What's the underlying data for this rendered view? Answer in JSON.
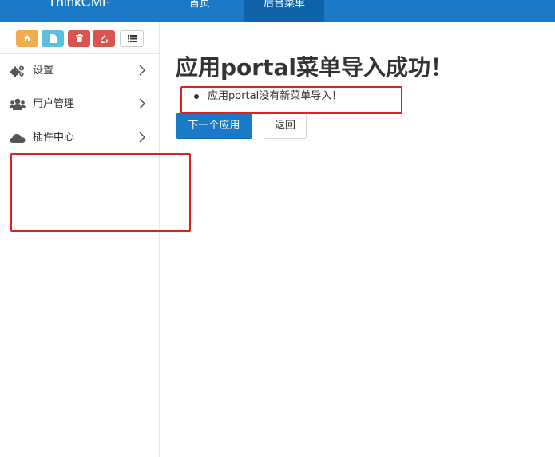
{
  "header": {
    "brand": "ThinkCMF",
    "nav": [
      {
        "label": "首页",
        "active": false
      },
      {
        "label": "后台菜单",
        "active": true
      }
    ],
    "colors": {
      "bar": "#1a7ac7",
      "active": "#0e63ab"
    }
  },
  "sidebar": {
    "shortcuts": [
      {
        "icon": "home-icon",
        "color": "#f0ad4e"
      },
      {
        "icon": "file-icon",
        "color": "#5bc0de"
      },
      {
        "icon": "trash-icon",
        "color": "#d9534f"
      },
      {
        "icon": "recycle-icon",
        "color": "#d9534f"
      },
      {
        "icon": "list-icon",
        "color": "#ffffff"
      }
    ],
    "items": [
      {
        "label": "设置",
        "icon": "gears-icon"
      },
      {
        "label": "用户管理",
        "icon": "users-icon"
      },
      {
        "label": "插件中心",
        "icon": "cloud-icon"
      }
    ]
  },
  "main": {
    "title": "应用portal菜单导入成功！",
    "messages": [
      "应用portal没有新菜单导入！"
    ],
    "next_button": "下一个应用",
    "back_button": "返回"
  }
}
